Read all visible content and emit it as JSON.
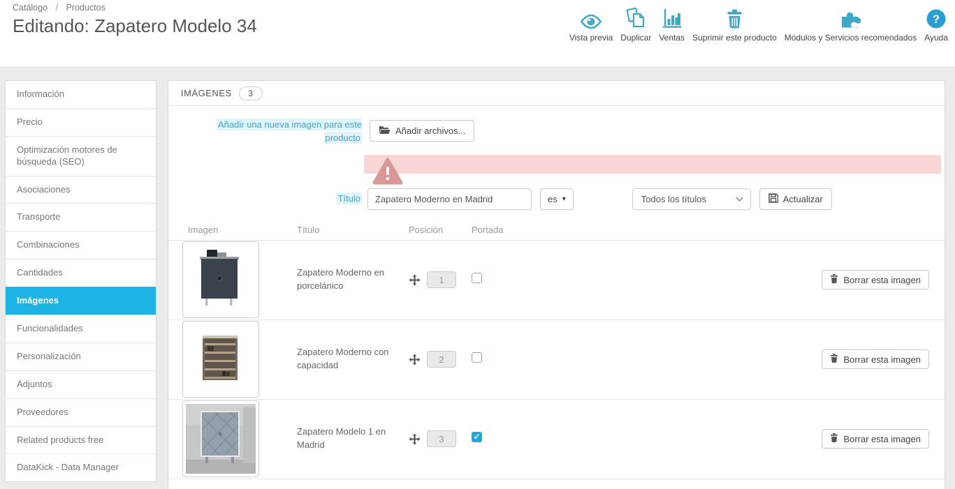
{
  "breadcrumb": {
    "catalog": "Catálogo",
    "separator": "/",
    "products": "Productos"
  },
  "header": {
    "title": "Editando: Zapatero Modelo 34"
  },
  "toolbar": {
    "preview": "Vista previa",
    "duplicate": "Duplicar",
    "sales": "Ventas",
    "delete_product": "Suprimir este producto",
    "modules": "Módulos y Servicios recomendados",
    "help": "Ayuda"
  },
  "sidebar": {
    "items": [
      {
        "label": "Información",
        "active": false
      },
      {
        "label": "Precio",
        "active": false
      },
      {
        "label": "Optimización motores de búsqueda (SEO)",
        "active": false
      },
      {
        "label": "Asociaciones",
        "active": false
      },
      {
        "label": "Transporte",
        "active": false
      },
      {
        "label": "Combinaciones",
        "active": false
      },
      {
        "label": "Cantidades",
        "active": false
      },
      {
        "label": "Imágenes",
        "active": true
      },
      {
        "label": "Funcionalidades",
        "active": false
      },
      {
        "label": "Personalización",
        "active": false
      },
      {
        "label": "Adjuntos",
        "active": false
      },
      {
        "label": "Proveedores",
        "active": false
      },
      {
        "label": "Related products free",
        "active": false
      },
      {
        "label": "DataKick - Data Manager",
        "active": false
      }
    ]
  },
  "panel": {
    "title": "IMÁGENES",
    "count": "3",
    "upload_label": "Añadir una nueva imagen para este producto",
    "upload_button": "Añadir archivos...",
    "title_field": {
      "label": "Título",
      "value": "Zapatero Moderno en Madrid",
      "language": "es",
      "titles_filter": "Todos los títulos",
      "update_button": "Actualizar"
    },
    "table": {
      "headers": {
        "image": "Imagen",
        "title": "Título",
        "position": "Posición",
        "cover": "Portada"
      },
      "rows": [
        {
          "title": "Zapatero Moderno en porcelánico",
          "position": "1",
          "cover": false,
          "delete_label": "Borrar esta imagen"
        },
        {
          "title": "Zapatero Moderno con capacidad",
          "position": "2",
          "cover": false,
          "delete_label": "Borrar esta imagen"
        },
        {
          "title": "Zapatero Modelo 1 en Madrid",
          "position": "3",
          "cover": true,
          "delete_label": "Borrar esta imagen"
        }
      ]
    }
  },
  "colors": {
    "accent_icon": "#3fa8c8",
    "help_circle": "#2b9fd2",
    "active_tab_bg": "#1db4e5",
    "link_label": "#4aa3c4",
    "link_label_bg": "#e1f3fb",
    "alert_bg": "#f9d6d6",
    "alert_icon": "#d99898",
    "checkbox_checked": "#1ea8de"
  }
}
